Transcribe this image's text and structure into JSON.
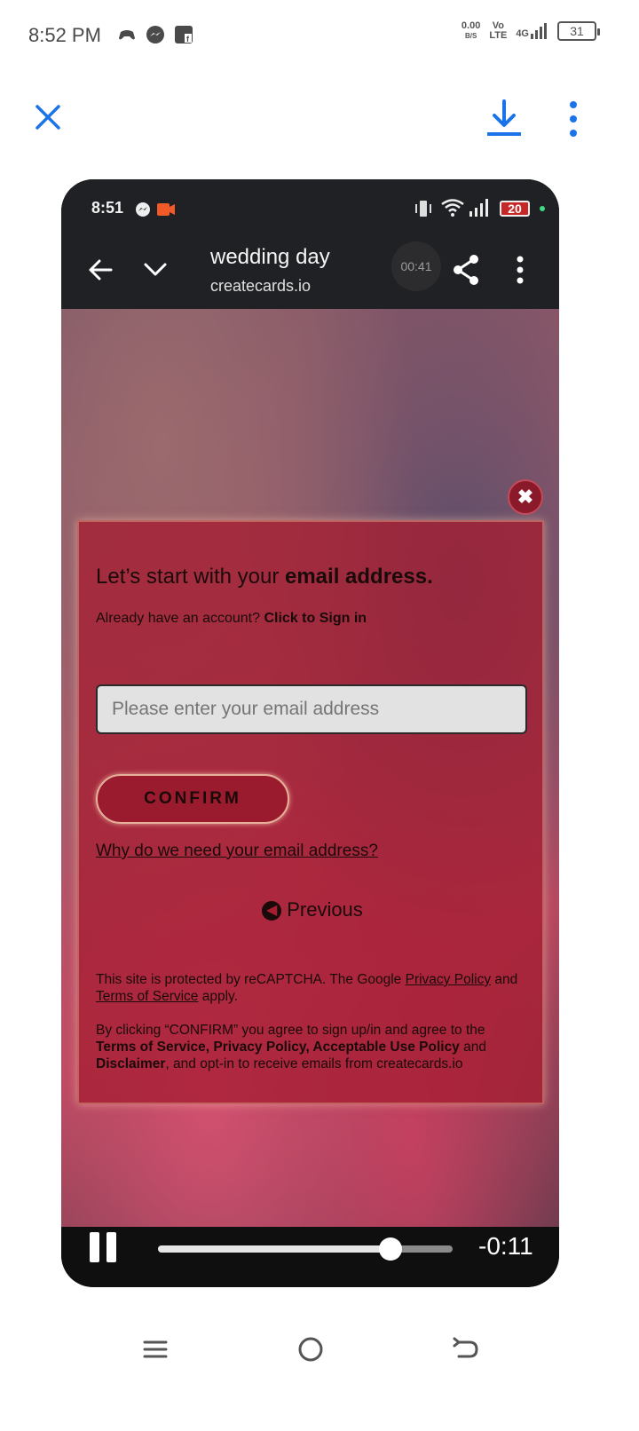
{
  "statusbar": {
    "time": "8:52 PM",
    "net_speed_value": "0.00",
    "net_speed_unit": "B/S",
    "volte_top": "Vo",
    "volte_bottom": "LTE",
    "network": "4G",
    "battery": "31"
  },
  "video": {
    "status_time": "8:51",
    "battery": "20",
    "title": "wedding day",
    "subtitle": "createcards.io",
    "elapsed": "00:41",
    "remaining": "-0:11",
    "progress": 0.79
  },
  "modal": {
    "heading_plain": "Let’s start with your ",
    "heading_bold": "email address.",
    "account_text": "Already have an account? ",
    "signin_link": "Click to Sign in",
    "email_placeholder": "Please enter your email address",
    "confirm_label": "CONFIRM",
    "why_link": "Why do we need your email address?",
    "previous_label": "Previous",
    "legal1_a": "This site is protected by reCAPTCHA. The Google ",
    "legal1_privacy": "Privacy Policy",
    "legal1_b": " and ",
    "legal1_terms": "Terms of Service",
    "legal1_c": " apply.",
    "legal2_a": "By clicking “CONFIRM” you agree to sign up/in and agree to the ",
    "legal2_terms": "Terms of Service, Privacy Policy, Acceptable Use Policy",
    "legal2_b": " and ",
    "legal2_disclaimer": "Disclaimer",
    "legal2_c": ", and opt-in to receive emails from createcards.io"
  },
  "colors": {
    "accent_blue": "#1a73e8",
    "modal_red": "#a51e32"
  }
}
